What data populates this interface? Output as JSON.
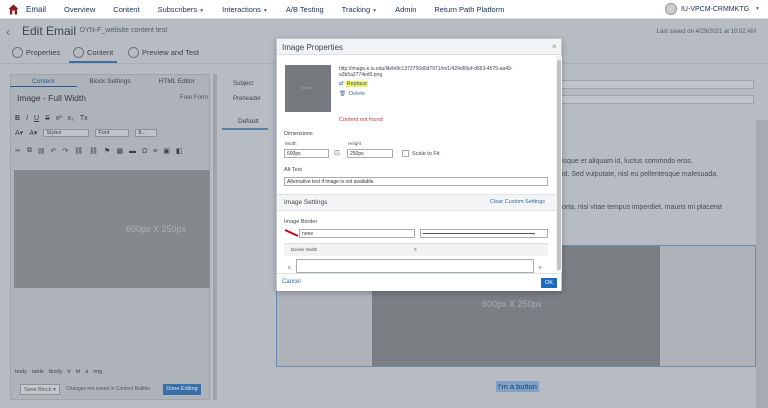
{
  "app": {
    "name": "Email"
  },
  "nav": {
    "items": [
      {
        "label": "Overview",
        "dropdown": false
      },
      {
        "label": "Content",
        "dropdown": false
      },
      {
        "label": "Subscribers",
        "dropdown": true
      },
      {
        "label": "Interactions",
        "dropdown": true
      },
      {
        "label": "A/B Testing",
        "dropdown": false
      },
      {
        "label": "Tracking",
        "dropdown": true
      },
      {
        "label": "Admin",
        "dropdown": false
      },
      {
        "label": "Return Path Platform",
        "dropdown": false
      }
    ],
    "user": "IU-VPCM-CRMMKTG"
  },
  "header": {
    "title": "Edit Email",
    "subtitle": "DYN-F_website content test",
    "saved": "Last saved on 4/29/2021 at 10:02 AM"
  },
  "steps": [
    {
      "label": "Properties"
    },
    {
      "label": "Content"
    },
    {
      "label": "Preview and Test"
    }
  ],
  "left_panel": {
    "tabs": [
      "Content",
      "Block Settings",
      "HTML Editor"
    ],
    "block_title": "Image - Full Width",
    "free_form": "Free Form",
    "styles_select": "Styles",
    "font_select": "Font",
    "size_select": "8...",
    "image_placeholder": "600px X 250px",
    "crumbs": [
      "body",
      "table",
      "tbody",
      "tr",
      "td",
      "a",
      "img"
    ],
    "save_block": "Save Block",
    "changes_note": "Changes not saved in Content Builder",
    "done_editing": "Done Editing"
  },
  "right_panel": {
    "subject_label": "Subject",
    "preheader_label": "Preheader",
    "default_tab": "Default",
    "line1": "isque et aliquam id, luctus commodo eros.",
    "line2": "id. Sed vulputate, nisl eu pellentesque malesuada,",
    "line3": "orta, nisi vitae tempus imperdiet, mauris mi placerat",
    "canvas_image": "600px X 250px",
    "button_text": "I'm a button"
  },
  "dialog": {
    "title": "Image Properties",
    "close": "×",
    "thumb_label": "No file",
    "url": "http://image.e.iu.edu/lib/fe8c1372756d0d7971/m/1/424d60ef-d563-4575-aa49-a3b5a2774ed0.png",
    "replace": "Replace",
    "delete": "Delete",
    "not_found": "Content not found",
    "dimensions_label": "Dimensions",
    "width_label": "Width",
    "width_value": "600px",
    "height_label": "Height",
    "height_value": "250px",
    "scale_to_fit": "Scale to Fit",
    "alt_label": "Alt Text",
    "alt_value": "Alternative text if image is not available",
    "image_settings": "Image Settings",
    "clear_settings": "Clear Custom Settings",
    "image_border": "Image Border",
    "border_style": "none",
    "border_width_label": "Border Width",
    "border_width_value": "0",
    "border_left": "0",
    "border_right": "0",
    "cancel": "Cancel",
    "ok": "OK"
  }
}
